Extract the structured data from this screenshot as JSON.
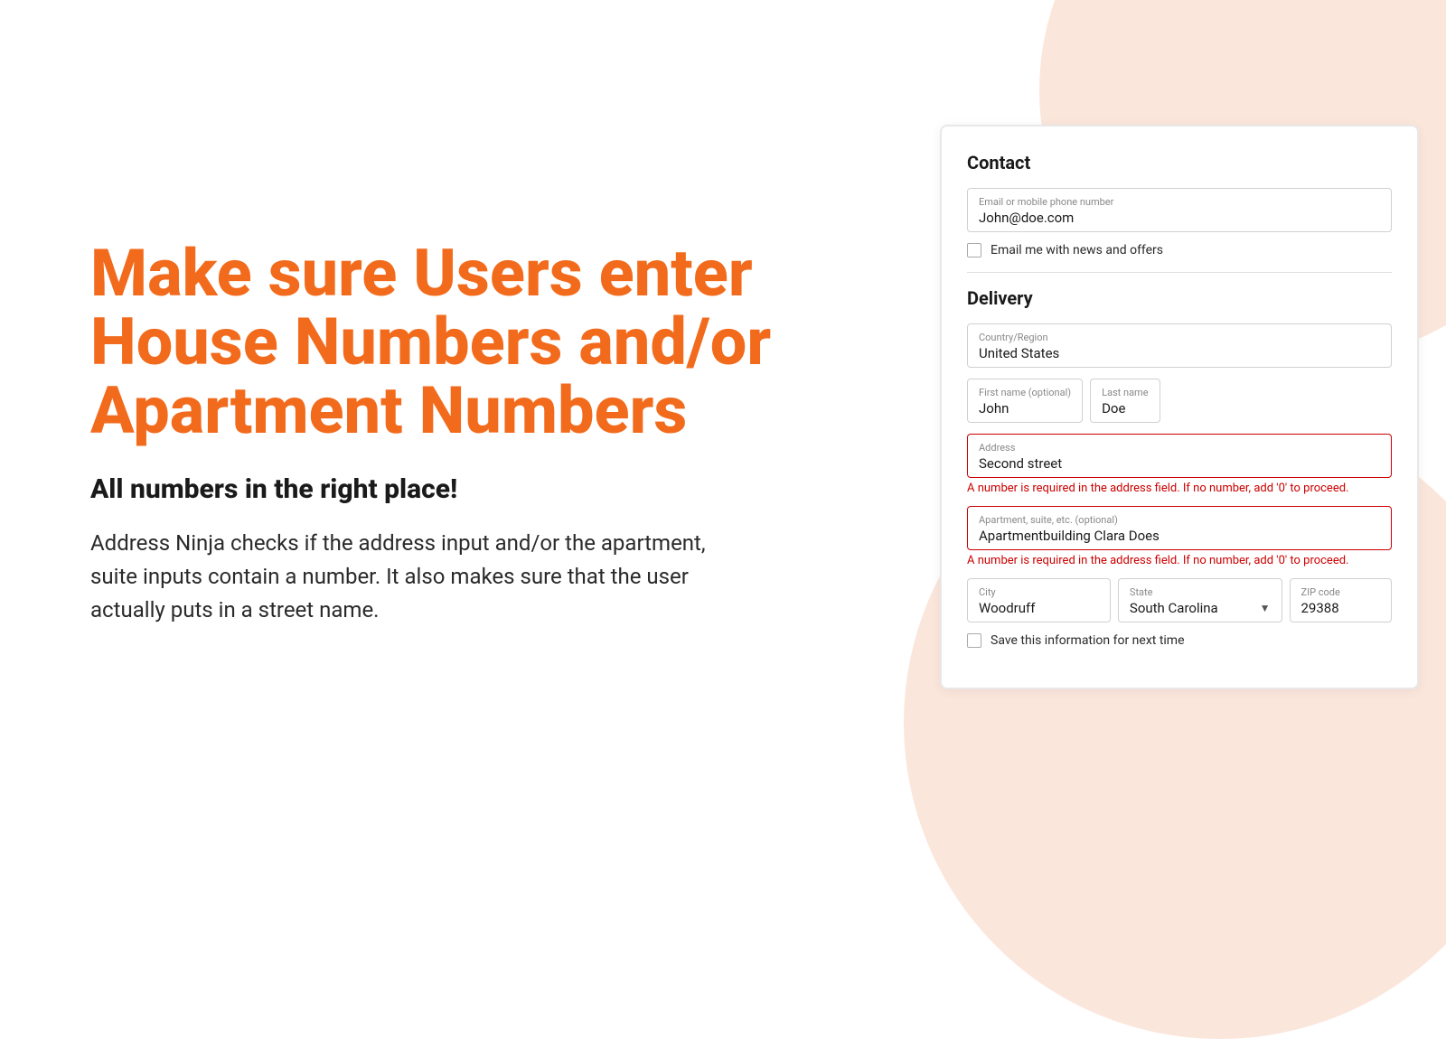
{
  "background": {
    "accent_color": "#f9d5c5"
  },
  "left": {
    "headline": "Make sure Users enter House Numbers and/or Apartment Numbers",
    "subheadline": "All numbers in the right place!",
    "description": "Address Ninja checks if the address input and/or the apartment, suite inputs contain a number. It also makes sure that the user actually puts in a street name."
  },
  "form": {
    "contact_title": "Contact",
    "delivery_title": "Delivery",
    "email_label": "Email or mobile phone number",
    "email_value": "John@doe.com",
    "email_checkbox_label": "Email me with news and offers",
    "country_label": "Country/Region",
    "country_value": "United States",
    "first_name_label": "First name (optional)",
    "first_name_value": "John",
    "last_name_label": "Last name",
    "last_name_value": "Doe",
    "address_label": "Address",
    "address_value": "Second street",
    "address_error": "A number is required in the address field. If no number, add '0' to proceed.",
    "apt_label": "Apartment, suite, etc. (optional)",
    "apt_value": "Apartmentbuilding Clara Does",
    "apt_error": "A number is required in the address field. If no number, add '0' to proceed.",
    "city_label": "City",
    "city_value": "Woodruff",
    "state_label": "State",
    "state_value": "South Carolina",
    "zip_label": "ZIP code",
    "zip_value": "29388",
    "save_checkbox_label": "Save this information for next time"
  }
}
